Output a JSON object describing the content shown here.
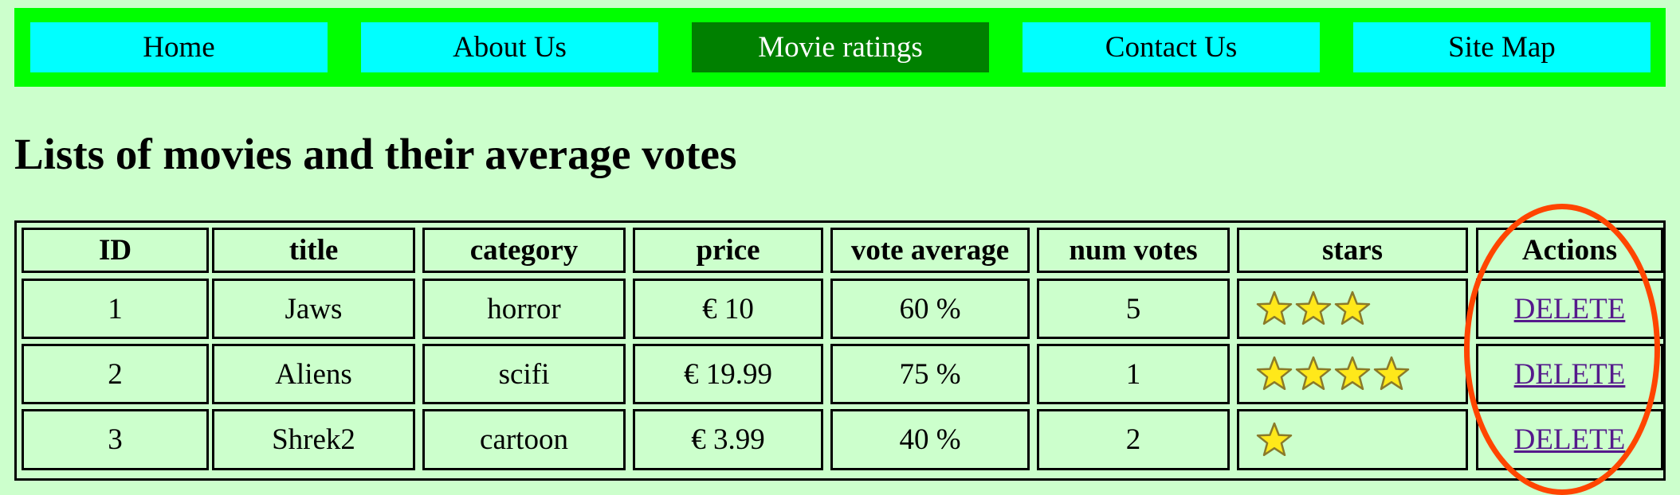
{
  "nav": {
    "items": [
      {
        "label": "Home",
        "active": false
      },
      {
        "label": "About Us",
        "active": false
      },
      {
        "label": "Movie ratings",
        "active": true
      },
      {
        "label": "Contact Us",
        "active": false
      },
      {
        "label": "Site Map",
        "active": false
      }
    ]
  },
  "page": {
    "title": "Lists of movies and their average votes"
  },
  "table": {
    "headers": [
      "ID",
      "title",
      "category",
      "price",
      "vote average",
      "num votes",
      "stars",
      "Actions"
    ],
    "rows": [
      {
        "id": "1",
        "title": "Jaws",
        "category": "horror",
        "price": "€ 10",
        "vote_average": "60 %",
        "num_votes": "5",
        "stars": 3,
        "action": "DELETE"
      },
      {
        "id": "2",
        "title": "Aliens",
        "category": "scifi",
        "price": "€ 19.99",
        "vote_average": "75 %",
        "num_votes": "1",
        "stars": 4,
        "action": "DELETE"
      },
      {
        "id": "3",
        "title": "Shrek2",
        "category": "cartoon",
        "price": "€ 3.99",
        "vote_average": "40 %",
        "num_votes": "2",
        "stars": 1,
        "action": "DELETE"
      }
    ]
  },
  "colors": {
    "page_background": "#ccffcc",
    "nav_background": "#00ff00",
    "nav_item": "#00ffff",
    "nav_item_active": "#008000",
    "link": "#551a8b",
    "star_fill": "#ffe81a",
    "highlight_ring": "#ff4500"
  },
  "annotation": {
    "highlight": "actions-column",
    "icon": "ellipse-highlight"
  }
}
